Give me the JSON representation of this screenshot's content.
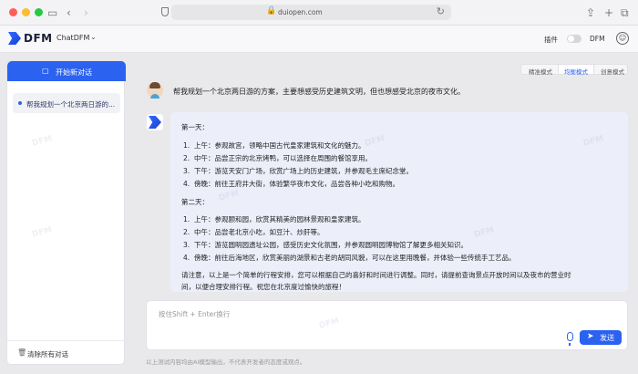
{
  "browser": {
    "url": "duiopen.com"
  },
  "header": {
    "logo_text": "DFM",
    "model": "ChatDFM",
    "plugin_label": "插件",
    "dfm_label": "DFM"
  },
  "sidebar": {
    "new_chat_label": "开始新对话",
    "chats": [
      {
        "label": "帮我规划一个北京两日游的..."
      }
    ],
    "clear_label": "清除所有对话"
  },
  "modes": {
    "tabs": [
      "精准模式",
      "均衡模式",
      "创意模式"
    ],
    "active": "均衡模式"
  },
  "conversation": {
    "user_message": "帮我规划一个北京两日游的方案，主要想感受历史建筑文明，但也想感受北京的夜市文化。",
    "bot": {
      "day1_title": "第一天：",
      "day1": [
        "上午：参观故宫，领略中国古代皇家建筑和文化的魅力。",
        "中午：品尝正宗的北京烤鸭，可以选择在周围的餐馆享用。",
        "下午：游览天安门广场，欣赏广场上的历史建筑，并参观毛主席纪念堂。",
        "傍晚：前往王府井大街，体验繁华夜市文化，品尝各种小吃和购物。"
      ],
      "day2_title": "第二天：",
      "day2": [
        "上午：参观颐和园，欣赏其精美的园林景观和皇家建筑。",
        "中午：品尝老北京小吃，如豆汁、炒肝等。",
        "下午：游览圆明园遗址公园，感受历史文化氛围，并参观圆明园博物馆了解更多相关知识。",
        "傍晚：前往后海地区，欣赏美丽的湖景和古老的胡同风貌，可以在这里用晚餐，并体验一些传统手工艺品。"
      ],
      "note_line1": "请注意，以上是一个简单的行程安排，您可以根据自己的喜好和时间进行调整。同时，请提前查询景点开放时间以及夜市的营业时",
      "note_line2": "间，以便合理安排行程。祝您在北京度过愉快的旅程！"
    }
  },
  "input": {
    "placeholder": "按住Shift + Enter换行",
    "send_label": "发送"
  },
  "disclaimer": "以上测试内容均由AI模型输出，不代表开发者的态度或观点。",
  "watermark_text": "DFM",
  "colors": {
    "accent": "#2b62f0",
    "bot_bubble": "#eceefa"
  }
}
